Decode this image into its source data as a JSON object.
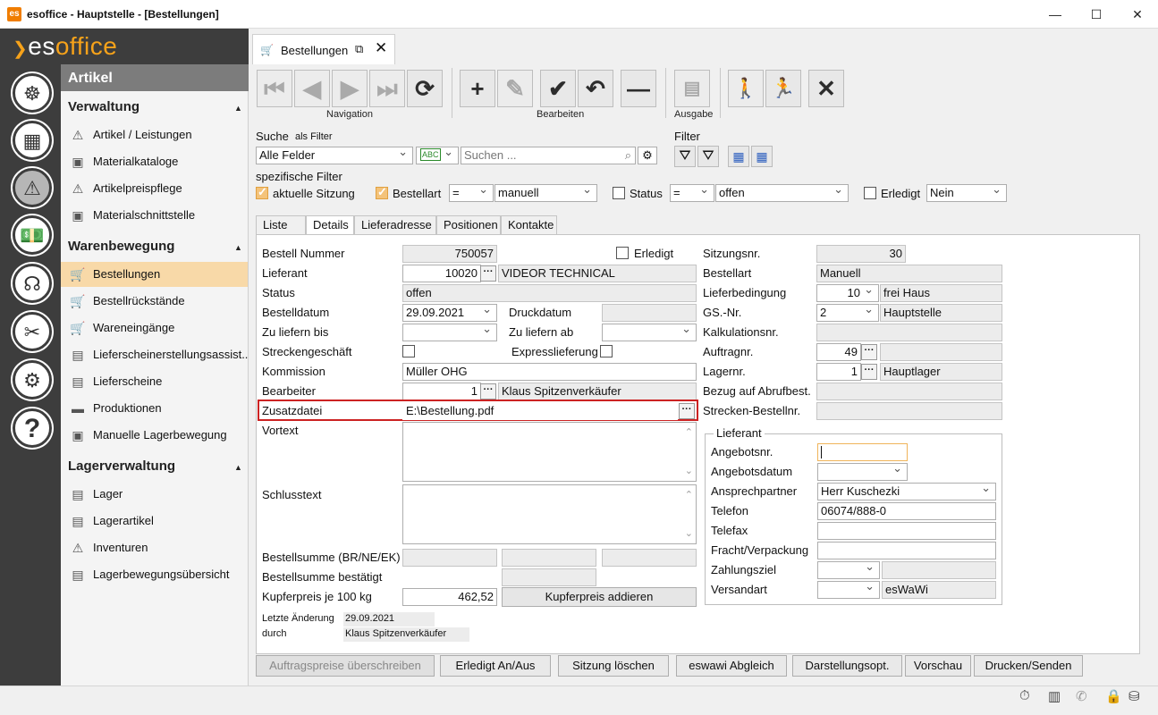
{
  "window": {
    "title": "esoffice - Hauptstelle - [Bestellungen]",
    "app_icon": "app-icon"
  },
  "logo": {
    "pre": "es",
    "post": "office"
  },
  "module": {
    "title": "Artikel"
  },
  "nav": {
    "sections": [
      {
        "title": "Verwaltung",
        "items": [
          "Artikel / Leistungen",
          "Materialkataloge",
          "Artikelpreispflege",
          "Materialschnittstelle"
        ]
      },
      {
        "title": "Warenbewegung",
        "items": [
          "Bestellungen",
          "Bestellrückstände",
          "Wareneingänge",
          "Lieferscheinerstellungsassist...",
          "Lieferscheine",
          "Produktionen",
          "Manuelle Lagerbewegung"
        ]
      },
      {
        "title": "Lagerverwaltung",
        "items": [
          "Lager",
          "Lagerartikel",
          "Inventuren",
          "Lagerbewegungsübersicht"
        ]
      }
    ],
    "selected": "Bestellungen"
  },
  "doc_tab": {
    "label": "Bestellungen"
  },
  "toolbar": {
    "navigation": "Navigation",
    "bearbeiten": "Bearbeiten",
    "ausgabe": "Ausgabe"
  },
  "search": {
    "label": "Suche",
    "sublabel": "als Filter",
    "field_value": "Alle Felder",
    "placeholder": "Suchen ...",
    "filter_label": "Filter"
  },
  "spec_filter": {
    "label": "spezifische Filter",
    "aktuelle_sitzung": "aktuelle Sitzung",
    "bestellart": "Bestellart",
    "bestellart_op": "=",
    "bestellart_val": "manuell",
    "status": "Status",
    "status_op": "=",
    "status_val": "offen",
    "erledigt": "Erledigt",
    "erledigt_val": "Nein"
  },
  "subtabs": [
    "Liste",
    "Details",
    "Lieferadresse",
    "Positionen",
    "Kontakte"
  ],
  "form": {
    "bestell_nummer": {
      "label": "Bestell Nummer",
      "value": "750057"
    },
    "erledigt": {
      "label": "Erledigt"
    },
    "lieferant": {
      "label": "Lieferant",
      "nr": "10020",
      "name": "VIDEOR TECHNICAL"
    },
    "status": {
      "label": "Status",
      "value": "offen"
    },
    "bestelldatum": {
      "label": "Bestelldatum",
      "value": "29.09.2021"
    },
    "druckdatum": {
      "label": "Druckdatum",
      "value": ""
    },
    "zu_liefern_bis": {
      "label": "Zu liefern bis"
    },
    "zu_liefern_ab": {
      "label": "Zu liefern ab"
    },
    "streckengeschaeft": {
      "label": "Streckengeschäft"
    },
    "expresslieferung": {
      "label": "Expresslieferung"
    },
    "kommission": {
      "label": "Kommission",
      "value": "Müller OHG"
    },
    "bearbeiter": {
      "label": "Bearbeiter",
      "nr": "1",
      "name": "Klaus Spitzenverkäufer"
    },
    "zusatzdatei": {
      "label": "Zusatzdatei",
      "value": "E:\\Bestellung.pdf"
    },
    "vortext": {
      "label": "Vortext"
    },
    "schlusstext": {
      "label": "Schlusstext"
    },
    "bestellsumme": {
      "label": "Bestellsumme (BR/NE/EK)"
    },
    "bestellsumme_best": {
      "label": "Bestellsumme bestätigt"
    },
    "kupferpreis": {
      "label": "Kupferpreis je 100 kg",
      "value": "462,52",
      "button": "Kupferpreis addieren"
    },
    "letzte_aenderung": {
      "label": "Letzte Änderung",
      "value": "29.09.2021"
    },
    "durch": {
      "label": "durch",
      "value": "Klaus Spitzenverkäufer"
    },
    "sitzungsnr": {
      "label": "Sitzungsnr.",
      "value": "30"
    },
    "bestellart": {
      "label": "Bestellart",
      "value": "Manuell"
    },
    "lieferbedingung": {
      "label": "Lieferbedingung",
      "nr": "10",
      "name": "frei Haus"
    },
    "gs_nr": {
      "label": "GS.-Nr.",
      "nr": "2",
      "name": "Hauptstelle"
    },
    "kalkulationsnr": {
      "label": "Kalkulationsnr."
    },
    "auftragnr": {
      "label": "Auftragnr.",
      "value": "49"
    },
    "lagernr": {
      "label": "Lagernr.",
      "nr": "1",
      "name": "Hauptlager"
    },
    "bezug": {
      "label": "Bezug auf Abrufbest."
    },
    "strecken": {
      "label": "Strecken-Bestellnr."
    }
  },
  "lieferant_box": {
    "title": "Lieferant",
    "angebotsnr": "Angebotsnr.",
    "angebotsdatum": "Angebotsdatum",
    "ansprechpartner": "Ansprechpartner",
    "ansprechpartner_val": "Herr Kuschezki",
    "telefon": "Telefon",
    "telefon_val": "06074/888-0",
    "telefax": "Telefax",
    "fracht": "Fracht/Verpackung",
    "zahlungsziel": "Zahlungsziel",
    "versandart": "Versandart",
    "versandart_val": "esWaWi"
  },
  "bottom_buttons": [
    "Auftragspreise überschreiben",
    "Erledigt An/Aus",
    "Sitzung löschen",
    "eswawi Abgleich",
    "Darstellungsopt.",
    "Vorschau",
    "Drucken/Senden"
  ],
  "colors": {
    "accent": "#f6a21a",
    "selected_nav": "#f8d9a8",
    "highlight_border": "#cc2222",
    "dark_bar": "#3d3d3d"
  }
}
